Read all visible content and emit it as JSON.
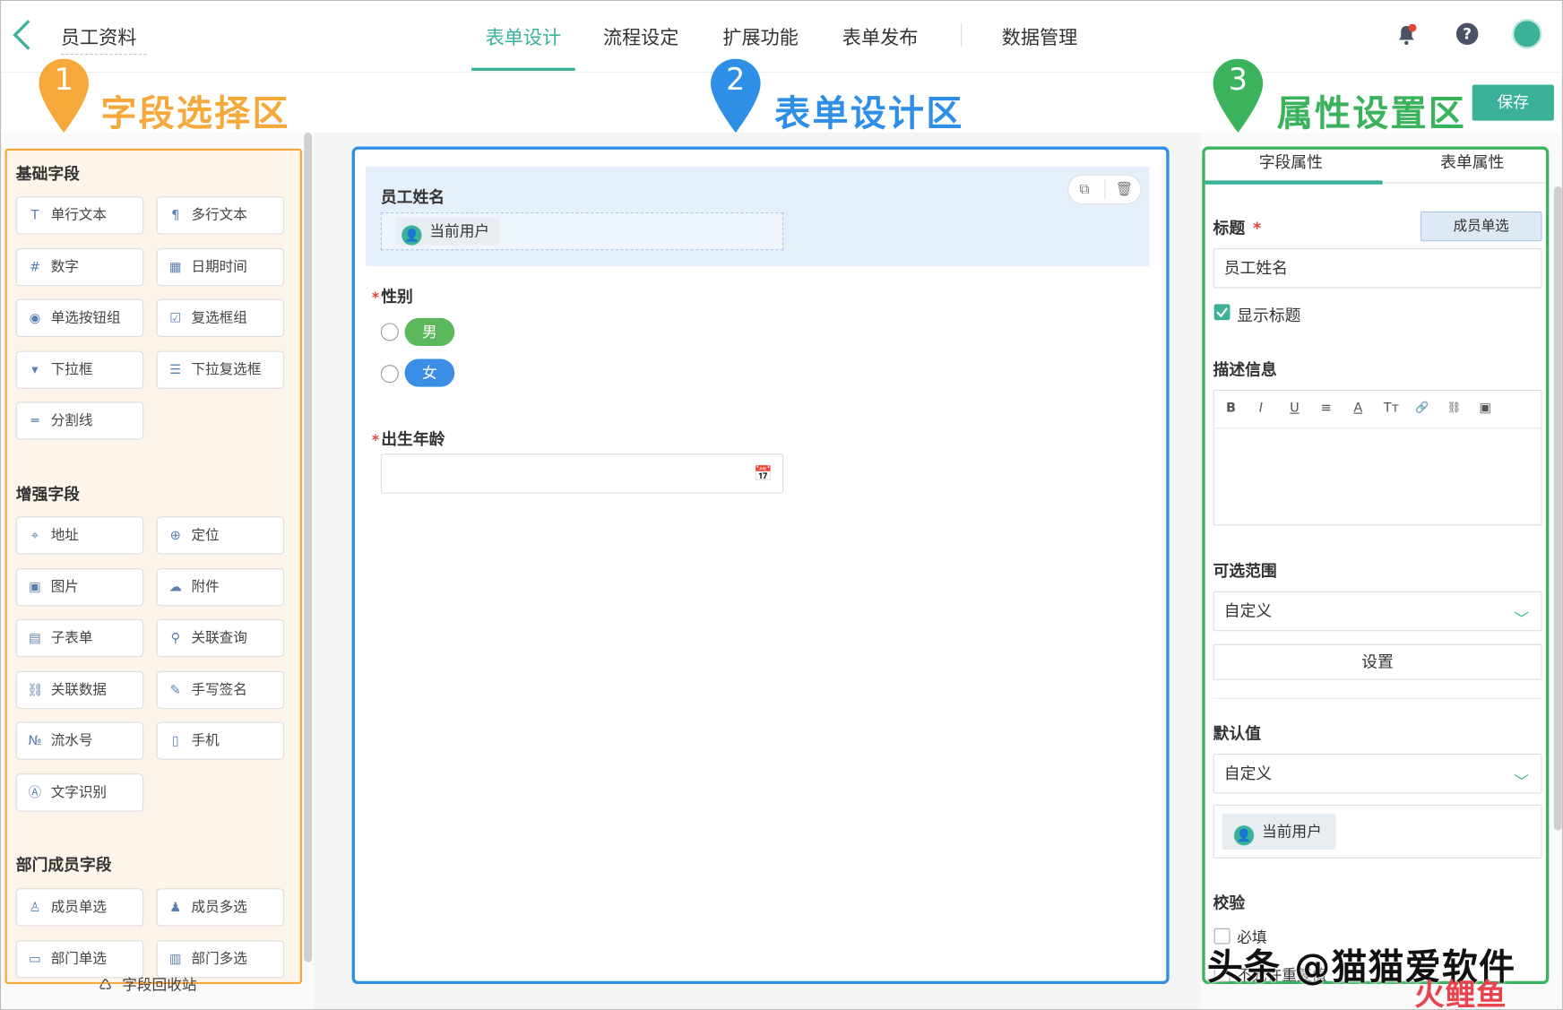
{
  "header": {
    "back_icon": "chevron-left-icon",
    "page_title": "员工资料",
    "tabs": [
      "表单设计",
      "流程设定",
      "扩展功能",
      "表单发布",
      "数据管理"
    ],
    "active_tab": 0,
    "accent_color": "#3bb19a"
  },
  "annotations": {
    "pin1": {
      "num": "1",
      "label": "字段选择区",
      "color": "#f4a93a"
    },
    "pin2": {
      "num": "2",
      "label": "表单设计区",
      "color": "#2f8fe6"
    },
    "pin3": {
      "num": "3",
      "label": "属性设置区",
      "color": "#3bb35c"
    }
  },
  "save_label": "保存",
  "left": {
    "basic_title": "基础字段",
    "basic": [
      {
        "label": "单行文本",
        "icon": "text-icon"
      },
      {
        "label": "多行文本",
        "icon": "textarea-icon"
      },
      {
        "label": "数字",
        "icon": "number-icon"
      },
      {
        "label": "日期时间",
        "icon": "calendar-icon"
      },
      {
        "label": "单选按钮组",
        "icon": "radio-icon"
      },
      {
        "label": "复选框组",
        "icon": "checkbox-icon"
      },
      {
        "label": "下拉框",
        "icon": "dropdown-icon"
      },
      {
        "label": "下拉复选框",
        "icon": "dropdown-multi-icon"
      },
      {
        "label": "分割线",
        "icon": "divider-icon"
      }
    ],
    "enhanced_title": "增强字段",
    "enhanced": [
      {
        "label": "地址",
        "icon": "map-pin-icon"
      },
      {
        "label": "定位",
        "icon": "locate-icon"
      },
      {
        "label": "图片",
        "icon": "image-icon"
      },
      {
        "label": "附件",
        "icon": "upload-icon"
      },
      {
        "label": "子表单",
        "icon": "subform-icon"
      },
      {
        "label": "关联查询",
        "icon": "link-query-icon"
      },
      {
        "label": "关联数据",
        "icon": "link-data-icon"
      },
      {
        "label": "手写签名",
        "icon": "pen-icon"
      },
      {
        "label": "流水号",
        "icon": "serial-icon"
      },
      {
        "label": "手机",
        "icon": "phone-icon"
      },
      {
        "label": "文字识别",
        "icon": "ocr-icon"
      }
    ],
    "member_title": "部门成员字段",
    "member": [
      {
        "label": "成员单选",
        "icon": "user-icon"
      },
      {
        "label": "成员多选",
        "icon": "users-icon"
      },
      {
        "label": "部门单选",
        "icon": "dept-icon"
      },
      {
        "label": "部门多选",
        "icon": "dept-multi-icon"
      }
    ],
    "recycle_label": "字段回收站"
  },
  "canvas": {
    "field1_label": "员工姓名",
    "field1_value": "当前用户",
    "field2_label": "性别",
    "field2_options": [
      {
        "label": "男",
        "color": "#5cb85c"
      },
      {
        "label": "女",
        "color": "#3a8ee6"
      }
    ],
    "field3_label": "出生年龄",
    "required_mark": "*"
  },
  "right": {
    "tabs": [
      "字段属性",
      "表单属性"
    ],
    "title_label": "标题",
    "title_badge": "成员单选",
    "title_value": "员工姓名",
    "show_title_label": "显示标题",
    "desc_label": "描述信息",
    "editor_tools": [
      "B",
      "I",
      "U",
      "≡",
      "A",
      "Tт",
      "🔗",
      "⛓",
      "▣"
    ],
    "range_label": "可选范围",
    "range_value": "自定义",
    "set_button": "设置",
    "default_label": "默认值",
    "default_value": "自定义",
    "default_user": "当前用户",
    "validate_label": "校验",
    "required_label": "必填",
    "unique_label": "不允许重复值"
  },
  "watermark": {
    "main": "头条 @猫猫爱软件",
    "corner": "火鲤鱼"
  }
}
